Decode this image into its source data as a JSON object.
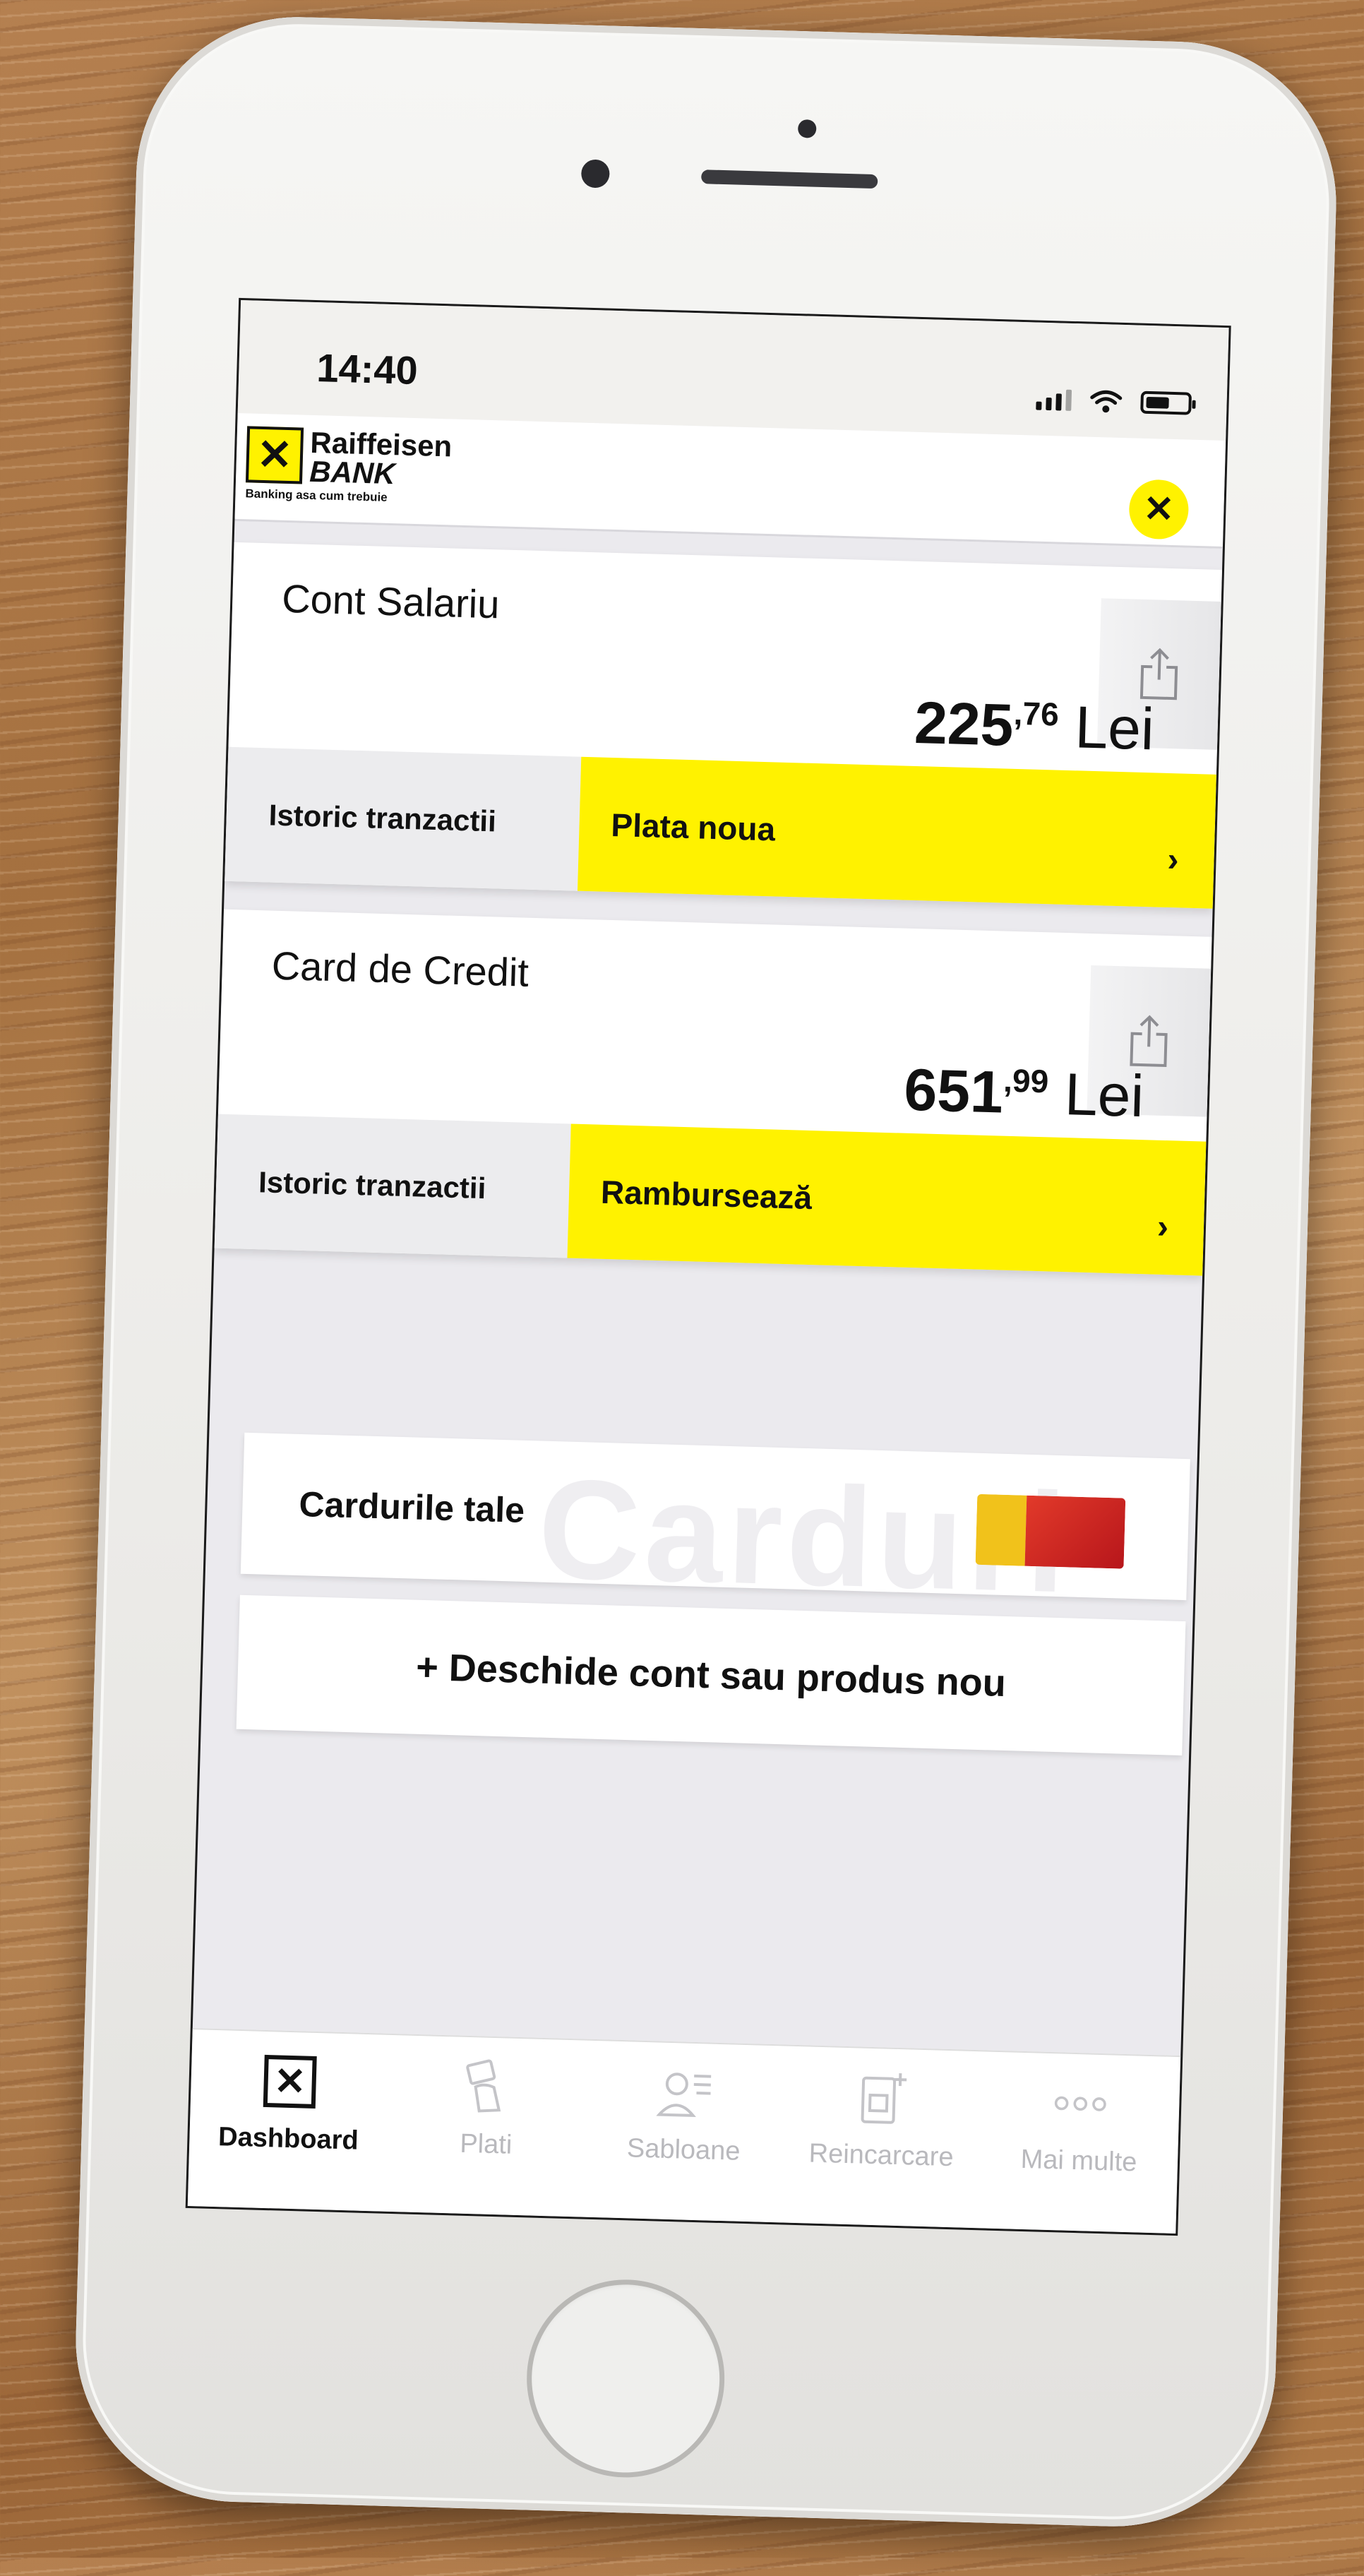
{
  "status_bar": {
    "time": "14:40"
  },
  "header": {
    "logo_name": "Raiffeisen",
    "logo_sub": "BANK",
    "logo_tagline": "Banking asa cum trebuie",
    "close_glyph": "✕"
  },
  "accounts": [
    {
      "name": "Cont Salariu",
      "balance_int": "225",
      "balance_dec": ",76",
      "currency": "Lei",
      "history_label": "Istoric tranzactii",
      "action_label": "Plata noua"
    },
    {
      "name": "Card de Credit",
      "balance_int": "651",
      "balance_dec": ",99",
      "currency": "Lei",
      "history_label": "Istoric tranzactii",
      "action_label": "Rambursează"
    }
  ],
  "cards_section": {
    "watermark": "Carduri",
    "label": "Cardurile tale"
  },
  "open_product": {
    "label": "+ Deschide cont sau produs nou"
  },
  "tab_bar": {
    "items": [
      {
        "label": "Dashboard",
        "icon": "dashboard-icon",
        "active": true
      },
      {
        "label": "Plati",
        "icon": "payments-icon",
        "active": false
      },
      {
        "label": "Sabloane",
        "icon": "templates-icon",
        "active": false
      },
      {
        "label": "Reincarcare",
        "icon": "topup-icon",
        "active": false
      },
      {
        "label": "Mai multe",
        "icon": "more-icon",
        "active": false
      }
    ]
  },
  "colors": {
    "accent": "#fff200",
    "background": "#ebeaee",
    "text": "#111111"
  }
}
